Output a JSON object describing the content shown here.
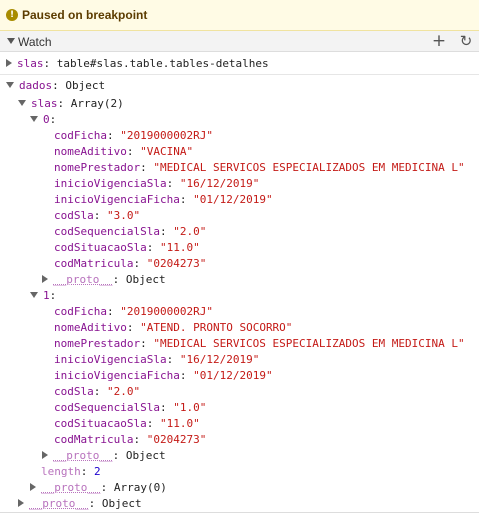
{
  "banner": {
    "icon": "pause-icon",
    "text": "Paused on breakpoint"
  },
  "watch": {
    "title": "Watch",
    "add_icon": "plus-icon",
    "refresh_icon": "refresh-icon"
  },
  "slas_expr": {
    "name": "slas",
    "value": "table#slas.table.tables-detalhes"
  },
  "dados": {
    "name": "dados",
    "type": "Object",
    "slas": {
      "name": "slas",
      "type": "Array(2)",
      "items": [
        {
          "index": "0",
          "fields": [
            {
              "key": "codFicha",
              "value": "\"2019000002RJ\""
            },
            {
              "key": "nomeAditivo",
              "value": "\"VACINA\""
            },
            {
              "key": "nomePrestador",
              "value": "\"MEDICAL SERVICOS ESPECIALIZADOS EM MEDICINA L\""
            },
            {
              "key": "inicioVigenciaSla",
              "value": "\"16/12/2019\""
            },
            {
              "key": "inicioVigenciaFicha",
              "value": "\"01/12/2019\""
            },
            {
              "key": "codSla",
              "value": "\"3.0\""
            },
            {
              "key": "codSequencialSla",
              "value": "\"2.0\""
            },
            {
              "key": "codSituacaoSla",
              "value": "\"11.0\""
            },
            {
              "key": "codMatricula",
              "value": "\"0204273\""
            }
          ],
          "proto": {
            "key": "__proto__",
            "value": "Object"
          }
        },
        {
          "index": "1",
          "fields": [
            {
              "key": "codFicha",
              "value": "\"2019000002RJ\""
            },
            {
              "key": "nomeAditivo",
              "value": "\"ATEND. PRONTO SOCORRO\""
            },
            {
              "key": "nomePrestador",
              "value": "\"MEDICAL SERVICOS ESPECIALIZADOS EM MEDICINA L\""
            },
            {
              "key": "inicioVigenciaSla",
              "value": "\"16/12/2019\""
            },
            {
              "key": "inicioVigenciaFicha",
              "value": "\"01/12/2019\""
            },
            {
              "key": "codSla",
              "value": "\"2.0\""
            },
            {
              "key": "codSequencialSla",
              "value": "\"1.0\""
            },
            {
              "key": "codSituacaoSla",
              "value": "\"11.0\""
            },
            {
              "key": "codMatricula",
              "value": "\"0204273\""
            }
          ],
          "proto": {
            "key": "__proto__",
            "value": "Object"
          }
        }
      ],
      "length": {
        "key": "length",
        "value": "2"
      },
      "proto": {
        "key": "__proto__",
        "value": "Array(0)"
      }
    },
    "proto": {
      "key": "__proto__",
      "value": "Object"
    }
  }
}
